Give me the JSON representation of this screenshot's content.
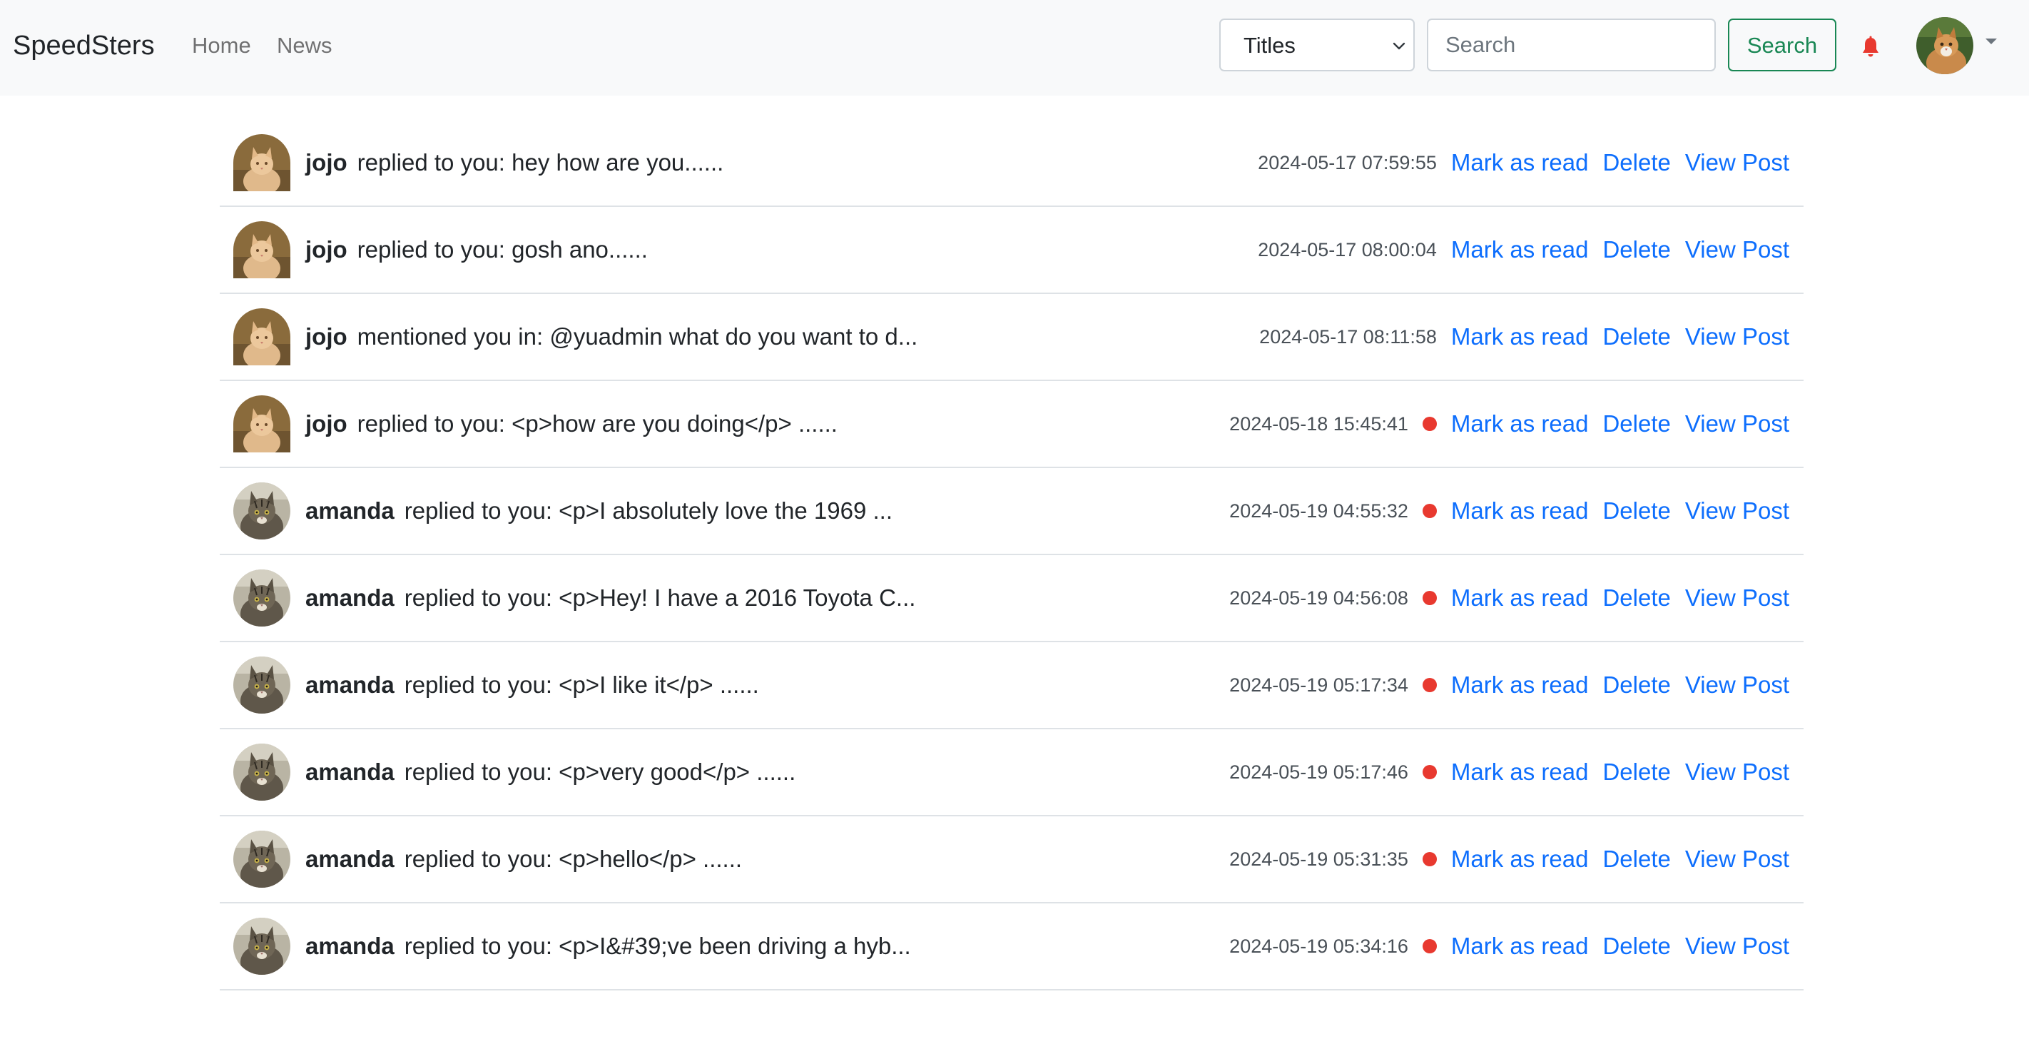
{
  "navbar": {
    "brand": "SpeedSters",
    "links": [
      "Home",
      "News"
    ],
    "search_type": "Titles",
    "search_placeholder": "Search",
    "search_button": "Search",
    "accent_color": "#198754",
    "bell_color": "#e8392f",
    "icons": [
      "bell-icon",
      "user-avatar",
      "caret-down-icon"
    ]
  },
  "actions": {
    "mark_read": "Mark as read",
    "delete": "Delete",
    "view_post": "View Post"
  },
  "notifications": [
    {
      "user": "jojo",
      "message": "replied to you: hey how are you......",
      "time": "2024-05-17 07:59:55",
      "unread": false,
      "avatar": "orange-cat"
    },
    {
      "user": "jojo",
      "message": "replied to you: gosh ano......",
      "time": "2024-05-17 08:00:04",
      "unread": false,
      "avatar": "orange-cat"
    },
    {
      "user": "jojo",
      "message": "mentioned you in: @yuadmin what do you want to d...",
      "time": "2024-05-17 08:11:58",
      "unread": false,
      "avatar": "orange-cat"
    },
    {
      "user": "jojo",
      "message": "replied to you: <p>how are you doing</p> ......",
      "time": "2024-05-18 15:45:41",
      "unread": true,
      "avatar": "orange-cat"
    },
    {
      "user": "amanda",
      "message": "replied to you: <p>I absolutely love the 1969 ...",
      "time": "2024-05-19 04:55:32",
      "unread": true,
      "avatar": "tabby-cat"
    },
    {
      "user": "amanda",
      "message": "replied to you: <p>Hey! I have a 2016 Toyota C...",
      "time": "2024-05-19 04:56:08",
      "unread": true,
      "avatar": "tabby-cat"
    },
    {
      "user": "amanda",
      "message": "replied to you: <p>I like it</p> ......",
      "time": "2024-05-19 05:17:34",
      "unread": true,
      "avatar": "tabby-cat"
    },
    {
      "user": "amanda",
      "message": "replied to you: <p>very good</p> ......",
      "time": "2024-05-19 05:17:46",
      "unread": true,
      "avatar": "tabby-cat"
    },
    {
      "user": "amanda",
      "message": "replied to you: <p>hello</p> ......",
      "time": "2024-05-19 05:31:35",
      "unread": true,
      "avatar": "tabby-cat"
    },
    {
      "user": "amanda",
      "message": "replied to you: <p>I&#39;ve been driving a hyb...",
      "time": "2024-05-19 05:34:16",
      "unread": true,
      "avatar": "tabby-cat"
    }
  ]
}
